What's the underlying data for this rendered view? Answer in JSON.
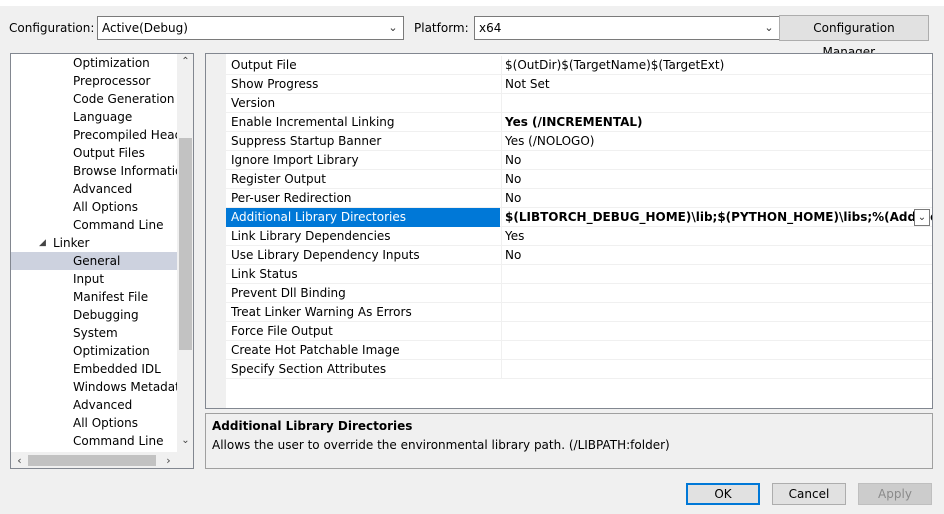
{
  "config_label": "Configuration:",
  "config_value": "Active(Debug)",
  "platform_label": "Platform:",
  "platform_value": "x64",
  "config_manager_label": "Configuration Manager...",
  "tree": [
    {
      "label": "Optimization",
      "indent": 2
    },
    {
      "label": "Preprocessor",
      "indent": 2
    },
    {
      "label": "Code Generation",
      "indent": 2
    },
    {
      "label": "Language",
      "indent": 2
    },
    {
      "label": "Precompiled Heade",
      "indent": 2
    },
    {
      "label": "Output Files",
      "indent": 2
    },
    {
      "label": "Browse Information",
      "indent": 2
    },
    {
      "label": "Advanced",
      "indent": 2
    },
    {
      "label": "All Options",
      "indent": 2
    },
    {
      "label": "Command Line",
      "indent": 2
    },
    {
      "label": "Linker",
      "indent": 1,
      "expanded": true
    },
    {
      "label": "General",
      "indent": 2,
      "selected": true
    },
    {
      "label": "Input",
      "indent": 2
    },
    {
      "label": "Manifest File",
      "indent": 2
    },
    {
      "label": "Debugging",
      "indent": 2
    },
    {
      "label": "System",
      "indent": 2
    },
    {
      "label": "Optimization",
      "indent": 2
    },
    {
      "label": "Embedded IDL",
      "indent": 2
    },
    {
      "label": "Windows Metadata",
      "indent": 2
    },
    {
      "label": "Advanced",
      "indent": 2
    },
    {
      "label": "All Options",
      "indent": 2
    },
    {
      "label": "Command Line",
      "indent": 2
    }
  ],
  "properties": [
    {
      "name": "Output File",
      "value": "$(OutDir)$(TargetName)$(TargetExt)"
    },
    {
      "name": "Show Progress",
      "value": "Not Set"
    },
    {
      "name": "Version",
      "value": ""
    },
    {
      "name": "Enable Incremental Linking",
      "value": "Yes (/INCREMENTAL)",
      "bold": true
    },
    {
      "name": "Suppress Startup Banner",
      "value": "Yes (/NOLOGO)"
    },
    {
      "name": "Ignore Import Library",
      "value": "No"
    },
    {
      "name": "Register Output",
      "value": "No"
    },
    {
      "name": "Per-user Redirection",
      "value": "No"
    },
    {
      "name": "Additional Library Directories",
      "value": "$(LIBTORCH_DEBUG_HOME)\\lib;$(PYTHON_HOME)\\libs;%(AdditionalLibrar",
      "bold": true,
      "selected": true
    },
    {
      "name": "Link Library Dependencies",
      "value": "Yes"
    },
    {
      "name": "Use Library Dependency Inputs",
      "value": "No"
    },
    {
      "name": "Link Status",
      "value": ""
    },
    {
      "name": "Prevent Dll Binding",
      "value": ""
    },
    {
      "name": "Treat Linker Warning As Errors",
      "value": ""
    },
    {
      "name": "Force File Output",
      "value": ""
    },
    {
      "name": "Create Hot Patchable Image",
      "value": ""
    },
    {
      "name": "Specify Section Attributes",
      "value": ""
    }
  ],
  "description": {
    "title": "Additional Library Directories",
    "text": "Allows the user to override the environmental library path. (/LIBPATH:folder)"
  },
  "buttons": {
    "ok": "OK",
    "cancel": "Cancel",
    "apply": "Apply"
  },
  "colors": {
    "selection": "#0078d7",
    "tree_selection": "#cdd2df"
  }
}
